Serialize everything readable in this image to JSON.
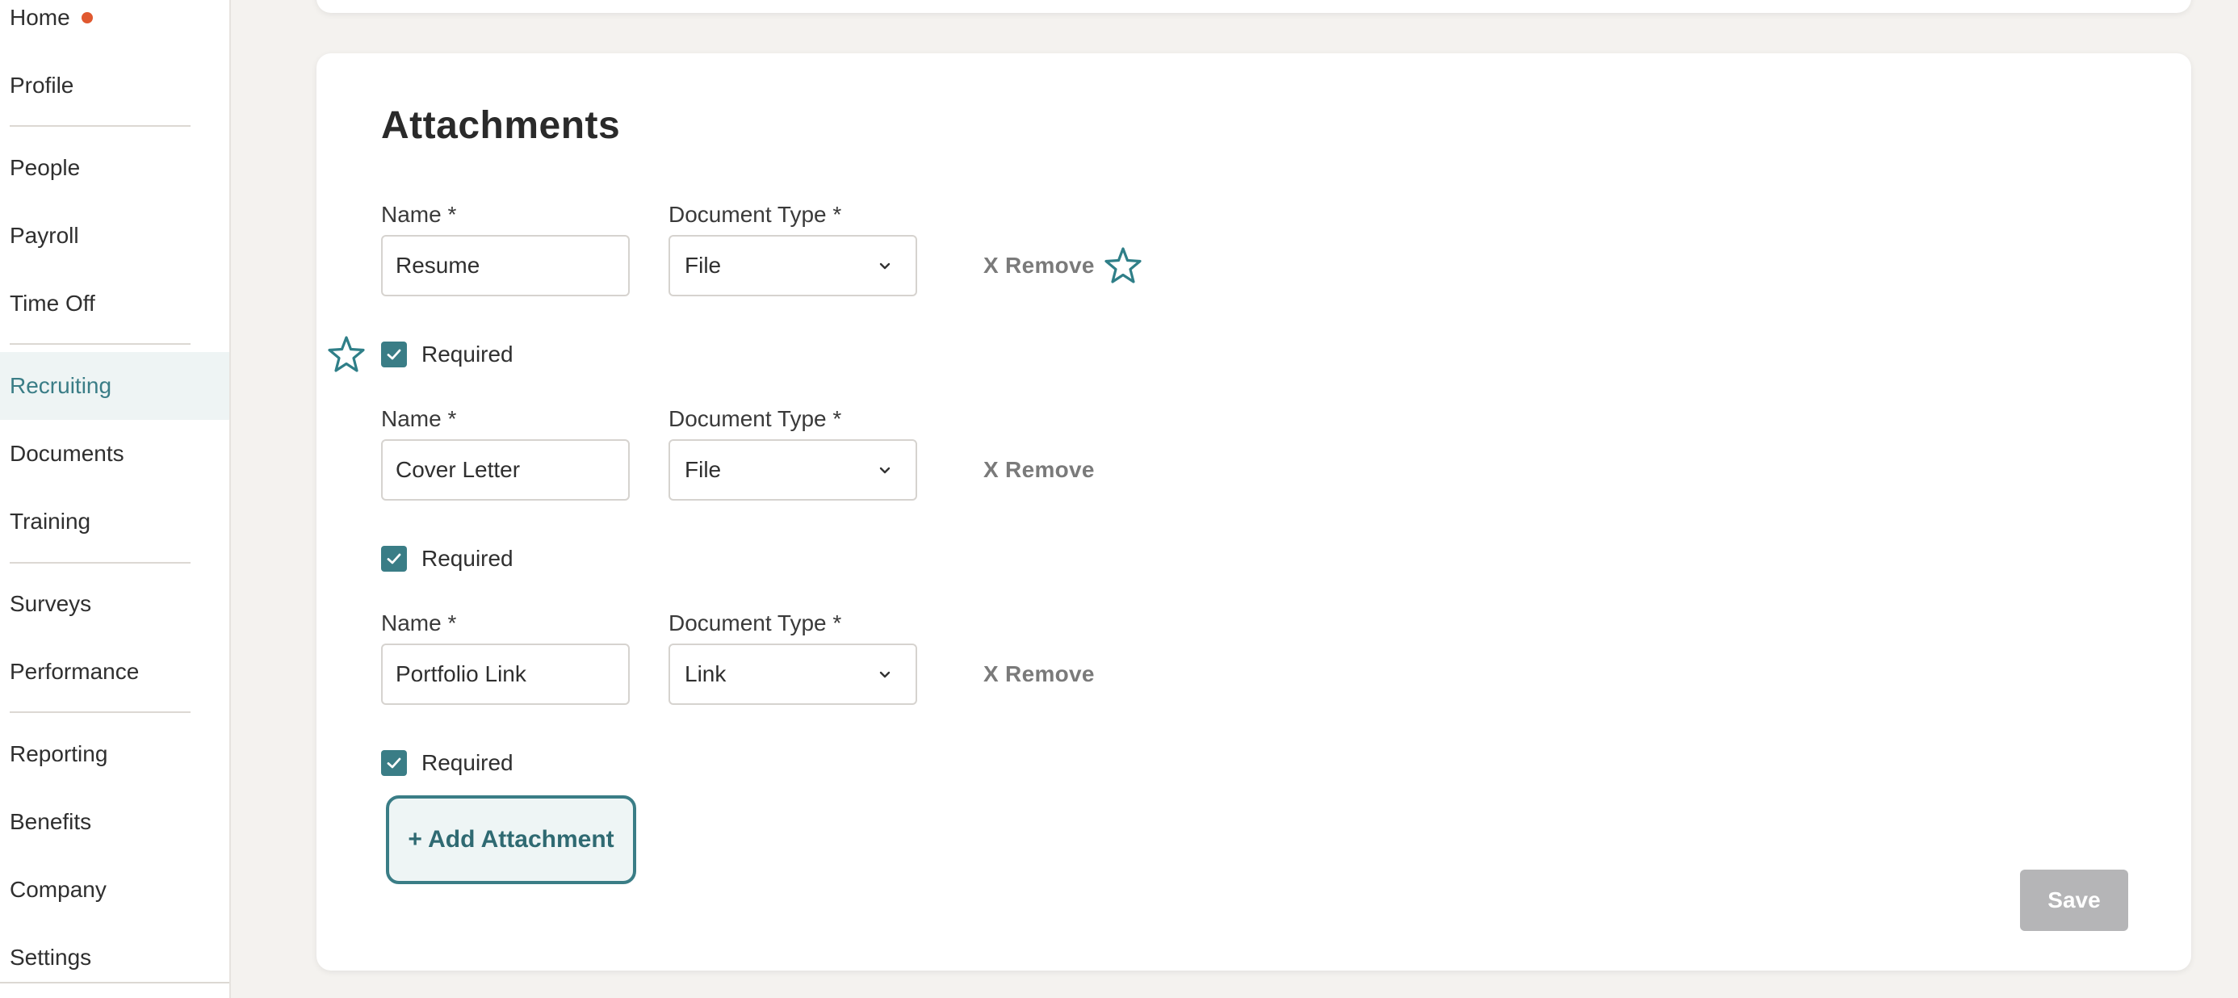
{
  "sidebar": {
    "items": [
      {
        "label": "Home"
      },
      {
        "label": "Profile"
      },
      {
        "label": "People"
      },
      {
        "label": "Payroll"
      },
      {
        "label": "Time Off"
      },
      {
        "label": "Recruiting"
      },
      {
        "label": "Documents"
      },
      {
        "label": "Training"
      },
      {
        "label": "Surveys"
      },
      {
        "label": "Performance"
      },
      {
        "label": "Reporting"
      },
      {
        "label": "Benefits"
      },
      {
        "label": "Company"
      },
      {
        "label": "Settings"
      }
    ],
    "active": "Recruiting",
    "notification_dot_color": "#e0582f"
  },
  "attachments": {
    "title": "Attachments",
    "name_label": "Name *",
    "type_label": "Document Type *",
    "remove_label": "X Remove",
    "required_label": "Required",
    "rows": [
      {
        "name": "Resume",
        "type": "File",
        "required": true
      },
      {
        "name": "Cover Letter",
        "type": "File",
        "required": true
      },
      {
        "name": "Portfolio Link",
        "type": "Link",
        "required": true
      }
    ],
    "add_button": "+ Add Attachment",
    "save_button": "Save"
  },
  "colors": {
    "accent": "#3a7d86",
    "background": "#f4f2ef",
    "save_disabled": "#b5b5b7"
  },
  "icons": [
    "star-icon",
    "chevron-down-icon",
    "checkmark-icon"
  ]
}
